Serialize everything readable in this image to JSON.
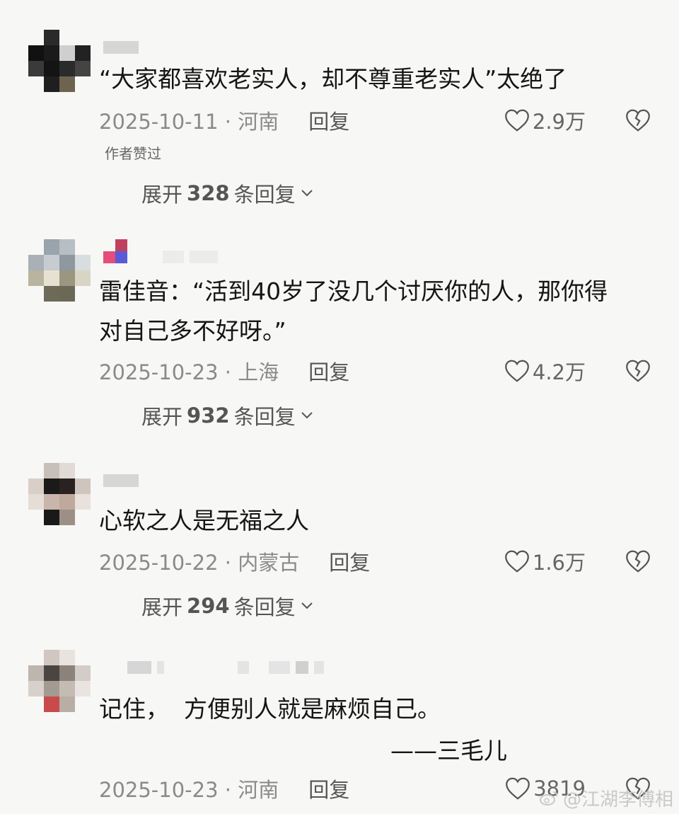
{
  "comments": [
    {
      "text": "“大家都喜欢老实人，却不尊重老实人”太绝了",
      "date_loc": "2025-10-11 · 河南",
      "reply": "回复",
      "likes": "2.9万",
      "badge": "作者赞过",
      "expand_prefix": "展开",
      "expand_count": "328",
      "expand_suffix": "条回复"
    },
    {
      "text": "雷佳音：“活到40岁了没几个讨厌你的人，那你得\n对自己多不好呀。”",
      "date_loc": "2025-10-23 · 上海",
      "reply": "回复",
      "likes": "4.2万",
      "expand_prefix": "展开",
      "expand_count": "932",
      "expand_suffix": "条回复"
    },
    {
      "text": "心软之人是无福之人",
      "date_loc": "2025-10-22 · 内蒙古",
      "reply": "回复",
      "likes": "1.6万",
      "expand_prefix": "展开",
      "expand_count": "294",
      "expand_suffix": "条回复"
    },
    {
      "text": "记住，  方便别人就是麻烦自己。",
      "quote_source": "——三毛儿",
      "date_loc": "2025-10-23 · 河南",
      "reply": "回复",
      "likes": "3819"
    }
  ],
  "watermark": "@江湖李傅相",
  "icons": {
    "like": "heart-outline-icon",
    "dislike": "broken-heart-icon",
    "expand": "chevron-down-icon"
  },
  "colors": {
    "background": "#f7f7f5",
    "meta_text": "#8a8a8a",
    "body_text": "#151515"
  }
}
